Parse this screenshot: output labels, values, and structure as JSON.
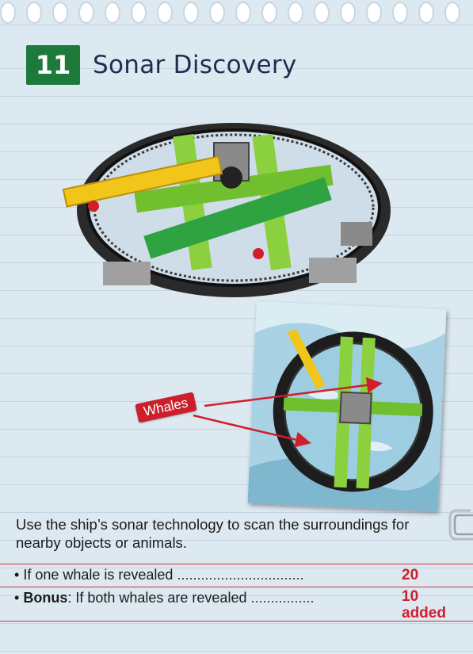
{
  "heading": {
    "number": "11",
    "title": "Sonar Discovery"
  },
  "photo": {
    "callout_label": "Whales"
  },
  "description": "Use the ship’s sonar technology to scan the surroundings for nearby objects or animals.",
  "scoring": [
    {
      "bullet": "•",
      "prefix": "",
      "text": "If one whale is revealed",
      "dots": "................................",
      "points": "20"
    },
    {
      "bullet": "•",
      "prefix": "Bonus",
      "text": ": If both whales are revealed",
      "dots": "................",
      "points": "10 added"
    }
  ],
  "colors": {
    "badge": "#1e7a3b",
    "accent_red": "#d11e2c",
    "paper": "#dde9f1",
    "title": "#1e2d4d"
  },
  "icons": [
    "spiral-binding-rings",
    "paper-clip-icon",
    "arrow-icon"
  ]
}
